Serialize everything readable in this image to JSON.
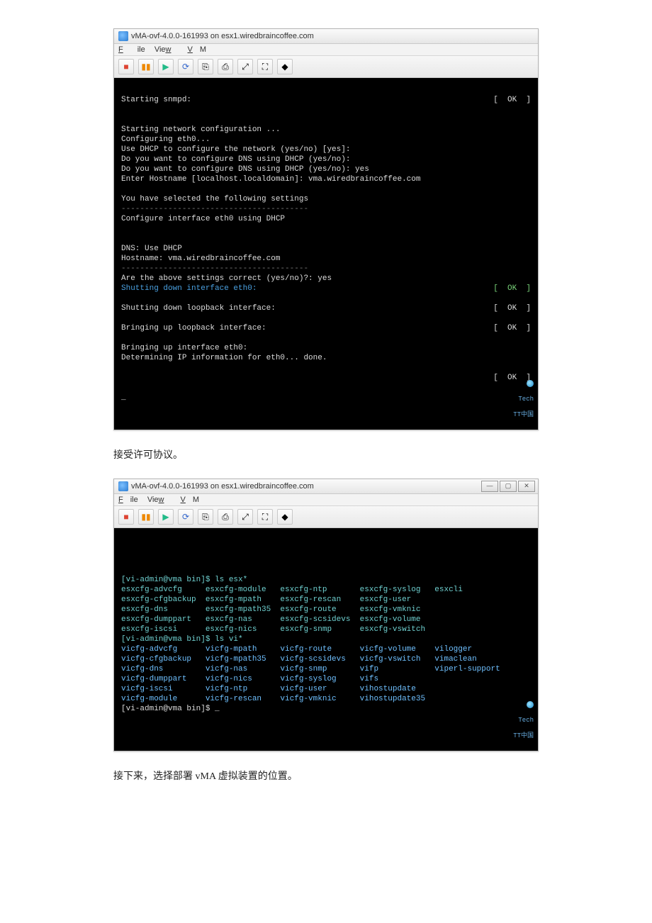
{
  "window": {
    "title": "vMA-ovf-4.0.0-161993 on esx1.wiredbraincoffee.com",
    "menus": {
      "file": "File",
      "view": "View",
      "vm": "VM"
    },
    "win_controls": {
      "min": "—",
      "max": "▢",
      "close": "✕"
    }
  },
  "toolbar_icons": [
    "■",
    "▮▮",
    "▶",
    "⟳",
    "⎘",
    "⎙",
    "⤢",
    "⛶",
    "◆"
  ],
  "console1": {
    "line_starting_snmpd": "Starting snmpd:",
    "status_ok_right": "[  OK  ]",
    "lines": [
      "Starting network configuration ...",
      "Configuring eth0...",
      "Use DHCP to configure the network (yes/no) [yes]:",
      "Do you want to configure DNS using DHCP (yes/no):",
      "Do you want to configure DNS using DHCP (yes/no): yes",
      "Enter Hostname [localhost.localdomain]: vma.wiredbraincoffee.com",
      "",
      "You have selected the following settings"
    ],
    "dash1": "----------------------------------------",
    "conf_line": "Configure interface eth0 using DHCP",
    "blank": "",
    "dns_line": "DNS: Use DHCP",
    "host_line": "Hostname: vma.wiredbraincoffee.com",
    "dash2": "----------------------------------------",
    "confirm": "Are the above settings correct (yes/no)?: yes",
    "shut_eth0": "Shutting down interface eth0:",
    "shut_lo": "Shutting down loopback interface:",
    "bring_lo": "Bringing up loopback interface:",
    "bring_eth": "Bringing up interface eth0:",
    "determ": "Determining IP information for eth0... done.",
    "ok": "[  OK  ]"
  },
  "caption1": "接受许可协议。",
  "console2": {
    "prompt1": "[vi-admin@vma bin]$ ls esx*",
    "esx_rows": [
      [
        "esxcfg-advcfg",
        "esxcfg-module",
        "esxcfg-ntp",
        "esxcfg-syslog",
        "esxcli"
      ],
      [
        "esxcfg-cfgbackup",
        "esxcfg-mpath",
        "esxcfg-rescan",
        "esxcfg-user",
        ""
      ],
      [
        "esxcfg-dns",
        "esxcfg-mpath35",
        "esxcfg-route",
        "esxcfg-vmknic",
        ""
      ],
      [
        "esxcfg-dumppart",
        "esxcfg-nas",
        "esxcfg-scsidevs",
        "esxcfg-volume",
        ""
      ],
      [
        "esxcfg-iscsi",
        "esxcfg-nics",
        "esxcfg-snmp",
        "esxcfg-vswitch",
        ""
      ]
    ],
    "prompt2": "[vi-admin@vma bin]$ ls vi*",
    "vi_rows": [
      [
        "vicfg-advcfg",
        "vicfg-mpath",
        "vicfg-route",
        "vicfg-volume",
        "vilogger"
      ],
      [
        "vicfg-cfgbackup",
        "vicfg-mpath35",
        "vicfg-scsidevs",
        "vicfg-vswitch",
        "vimaclean"
      ],
      [
        "vicfg-dns",
        "vicfg-nas",
        "vicfg-snmp",
        "vifp",
        "viperl-support"
      ],
      [
        "vicfg-dumppart",
        "vicfg-nics",
        "vicfg-syslog",
        "vifs",
        ""
      ],
      [
        "vicfg-iscsi",
        "vicfg-ntp",
        "vicfg-user",
        "vihostupdate",
        ""
      ],
      [
        "vicfg-module",
        "vicfg-rescan",
        "vicfg-vmknic",
        "vihostupdate35",
        ""
      ]
    ],
    "prompt3": "[vi-admin@vma bin]$ _"
  },
  "caption2": "接下来，选择部署 vMA 虚拟装置的位置。",
  "watermark": {
    "brand": "Tech",
    "sub": "TT中国"
  }
}
